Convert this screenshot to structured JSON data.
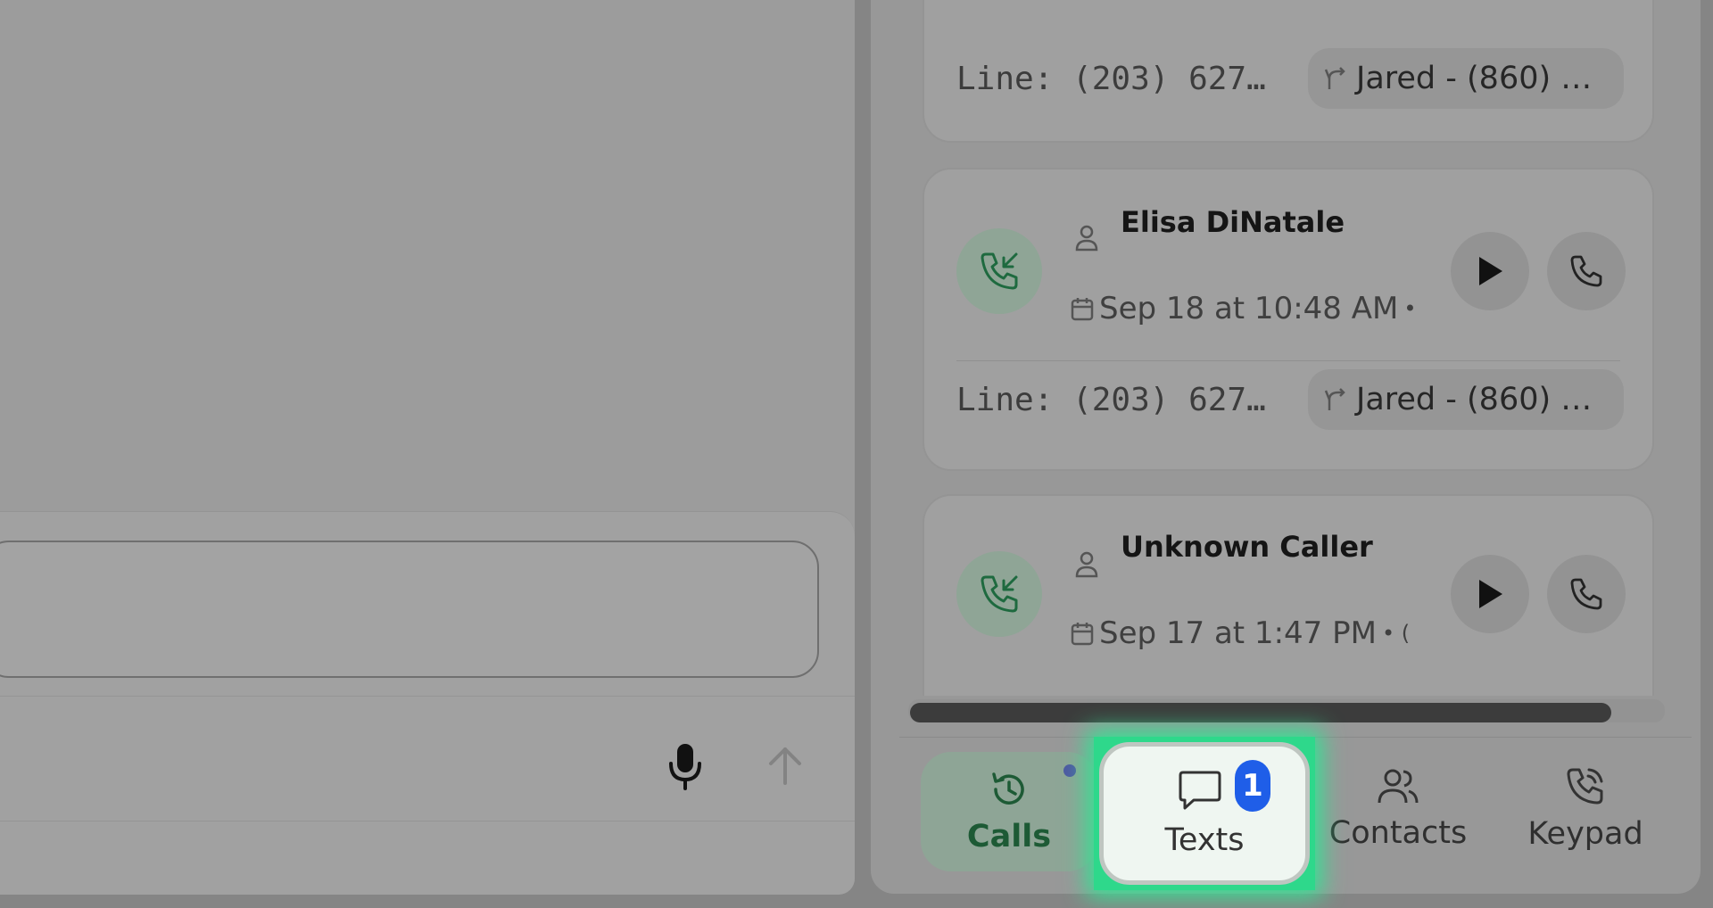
{
  "calls": [
    {
      "name": "",
      "date": "",
      "line": "Line: (203) 627…",
      "routed_to": "Jared - (860) …"
    },
    {
      "name": "Elisa DiNatale",
      "date": "Sep 18 at 10:48 AM",
      "date_suffix": "•",
      "line": "Line: (203) 627…",
      "routed_to": "Jared - (860) …"
    },
    {
      "name": "Unknown Caller",
      "date": "Sep 17 at 1:47 PM",
      "date_suffix": "• (",
      "line": "",
      "routed_to": ""
    }
  ],
  "nav": {
    "calls": "Calls",
    "texts": "Texts",
    "texts_badge": "1",
    "contacts": "Contacts",
    "keypad": "Keypad"
  },
  "icons": {
    "direction": "incoming-call-icon",
    "person": "person-icon",
    "calendar": "calendar-icon",
    "play": "play-icon",
    "phone": "phone-icon",
    "route": "route-icon",
    "mic": "microphone-icon",
    "send": "arrow-up-icon",
    "calls_tab": "history-icon",
    "texts_tab": "message-icon",
    "contacts_tab": "contacts-icon",
    "keypad_tab": "phone-keypad-icon"
  },
  "colors": {
    "accent_green": "#2ed88b",
    "badge_blue": "#1f5ee8",
    "calls_tab_text": "#1d5a35"
  }
}
